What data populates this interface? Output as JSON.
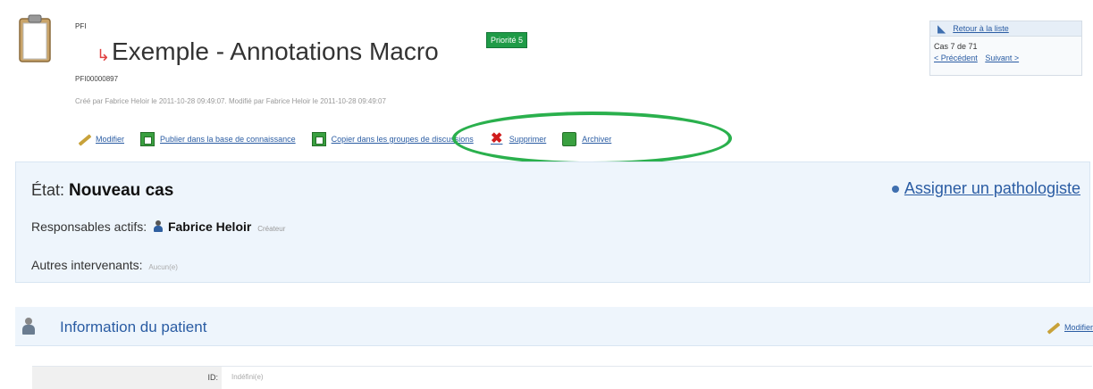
{
  "header": {
    "code": "PFI",
    "title": "Exemple - Annotations Macro",
    "priority": "Priorité 5",
    "case_id": "PFI00000897",
    "meta": "Créé par Fabrice Heloir le 2011-10-28 09:49:07. Modifié par Fabrice Heloir le 2011-10-28 09:49:07"
  },
  "actions": {
    "edit": "Modifier",
    "publish": "Publier dans la base de connaissance",
    "copy": "Copier dans les groupes de discussions",
    "delete": "Supprimer",
    "archive": "Archiver"
  },
  "nav": {
    "back": "Retour à la liste",
    "count": "Cas 7 de 71",
    "prev": "< Précédent",
    "next": "Suivant >"
  },
  "status": {
    "state_label": "État:",
    "state_value": "Nouveau cas",
    "assign": "Assigner un pathologiste",
    "resp_label": "Responsables actifs:",
    "resp_name": "Fabrice Heloir",
    "resp_role": "Créateur",
    "others_label": "Autres intervenants:",
    "others_value": "Aucun(e)"
  },
  "patient": {
    "title": "Information du patient",
    "edit": "Modifier",
    "id_label": "ID:",
    "id_value": "Indéfini(e)"
  },
  "colors": {
    "accent": "#2a5ca3",
    "priority": "#1f9b47",
    "highlight": "#2ab04d",
    "panel": "#eef5fc"
  },
  "icons": [
    "clipboard-icon",
    "arrow-icon",
    "pencil-icon",
    "publish-icon",
    "copy-icon",
    "delete-icon",
    "archive-icon",
    "back-icon",
    "person-icon",
    "patient-icon"
  ]
}
